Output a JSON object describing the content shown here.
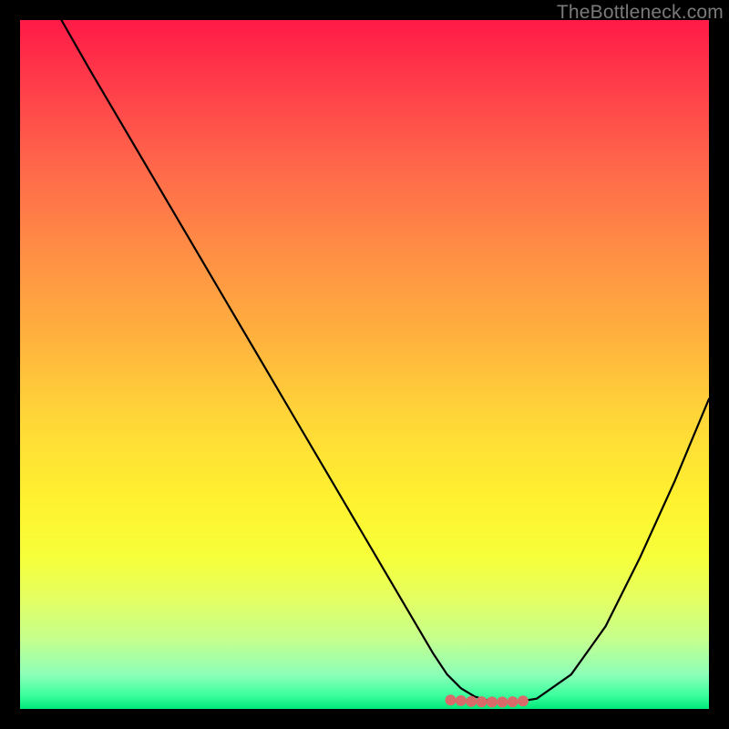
{
  "watermark": "TheBottleneck.com",
  "colors": {
    "frame": "#000000",
    "curve": "#000000",
    "dot": "#d96a6a",
    "gradient_top": "#ff1a47",
    "gradient_bottom": "#00e878"
  },
  "chart_data": {
    "type": "line",
    "title": "",
    "xlabel": "",
    "ylabel": "",
    "xlim": [
      0,
      100
    ],
    "ylim": [
      0,
      100
    ],
    "grid": false,
    "legend": false,
    "series": [
      {
        "name": "bottleneck-curve",
        "x": [
          6,
          10,
          15,
          20,
          25,
          30,
          35,
          40,
          45,
          50,
          55,
          60,
          62,
          64,
          66,
          68,
          70,
          72,
          75,
          80,
          85,
          90,
          95,
          100
        ],
        "values": [
          100,
          93,
          84.5,
          76,
          67.5,
          59,
          50.5,
          42,
          33.5,
          25,
          16.5,
          8,
          5,
          3,
          1.8,
          1.2,
          1.0,
          1.0,
          1.5,
          5,
          12,
          22,
          33,
          45
        ]
      }
    ],
    "dots": {
      "name": "flat-minimum",
      "x": [
        62.5,
        64,
        65.5,
        67,
        68.5,
        70,
        71.5,
        73
      ],
      "values": [
        1.3,
        1.2,
        1.1,
        1.05,
        1.0,
        1.0,
        1.05,
        1.15
      ]
    }
  }
}
